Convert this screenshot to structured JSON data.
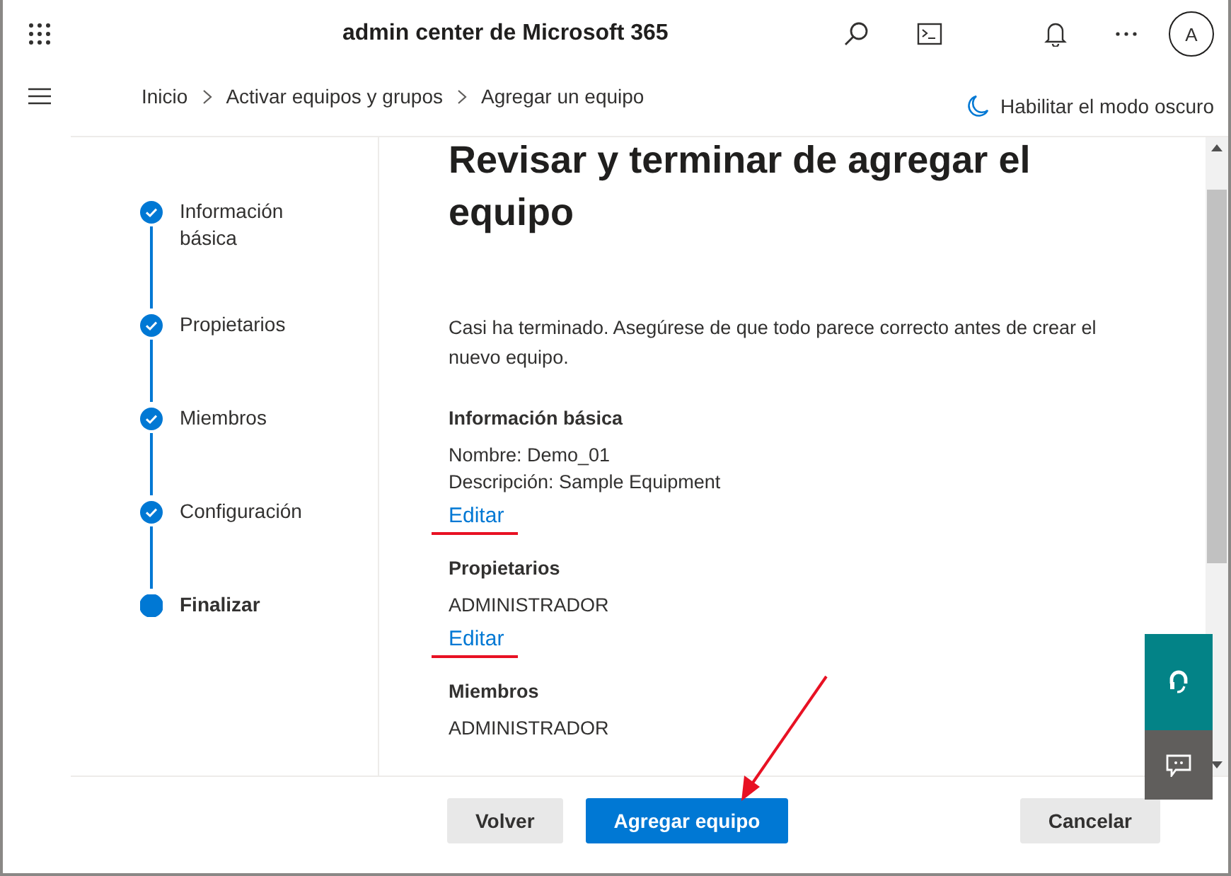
{
  "header": {
    "title": "admin center de Microsoft 365",
    "avatar": "A"
  },
  "breadcrumb": [
    "Inicio",
    "Activar equipos y grupos",
    "Agregar un equipo"
  ],
  "dark_mode_link": "Habilitar el modo oscuro",
  "steps": [
    {
      "label": "Información básica",
      "completed": true,
      "selected": false
    },
    {
      "label": "Propietarios",
      "completed": true,
      "selected": false
    },
    {
      "label": "Miembros",
      "completed": true,
      "selected": false
    },
    {
      "label": "Configuración",
      "completed": true,
      "selected": false
    },
    {
      "label": "Finalizar",
      "completed": false,
      "selected": true
    }
  ],
  "heading": "Revisar y terminar de agregar el equipo",
  "intro": "Casi ha terminado. Asegúrese de que todo parece correcto antes de crear el nuevo equipo.",
  "sections": [
    {
      "title": "Información básica",
      "lines": [
        "Nombre: Demo_01",
        "Descripción: Sample Equipment"
      ],
      "edit_link": "Editar",
      "underlined": true
    },
    {
      "title": "Propietarios",
      "lines": [
        "ADMINISTRADOR"
      ],
      "edit_link": "Editar",
      "underlined": true
    },
    {
      "title": "Miembros",
      "lines": [
        "ADMINISTRADOR"
      ],
      "underlined": false
    }
  ],
  "buttons": [
    {
      "label": "Volver",
      "kind": "secondary"
    },
    {
      "label": "Agregar equipo",
      "kind": "primary"
    },
    {
      "label": "Cancelar",
      "kind": "secondary"
    }
  ],
  "annotation_arrow": true
}
